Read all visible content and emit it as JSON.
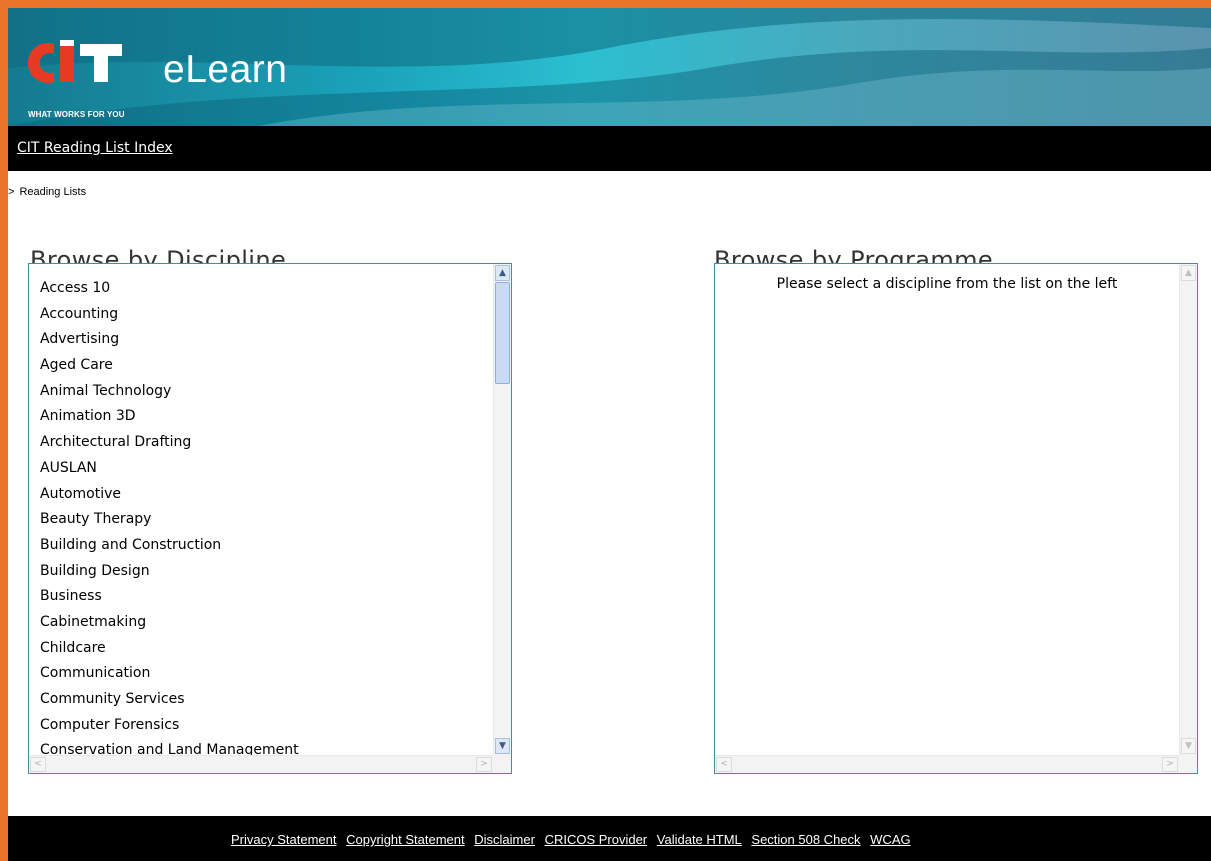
{
  "header": {
    "logo_text": "CIT",
    "logo_tagline": "WHAT WORKS FOR YOU",
    "app_title": "eLearn",
    "colors": {
      "frame": "#e9742a",
      "logo_red": "#e63a23",
      "logo_white": "#ffffff"
    }
  },
  "nav": {
    "index_link": "CIT Reading List Index"
  },
  "breadcrumb": {
    "separator": ">",
    "current": "Reading Lists"
  },
  "discipline": {
    "heading": "Browse by Discipline",
    "items": [
      "Access 10",
      "Accounting",
      "Advertising",
      "Aged Care",
      "Animal Technology",
      "Animation 3D",
      "Architectural Drafting",
      "AUSLAN",
      "Automotive",
      "Beauty Therapy",
      "Building and Construction",
      "Building Design",
      "Business",
      "Cabinetmaking",
      "Childcare",
      "Communication",
      "Community Services",
      "Computer Forensics",
      "Conservation and Land Management"
    ]
  },
  "programme": {
    "heading": "Browse by Programme",
    "message": "Please select a discipline from the list on the left"
  },
  "footer": {
    "links": [
      "Privacy Statement",
      "Copyright Statement",
      "Disclaimer",
      "CRICOS Provider",
      "Validate HTML",
      "Section 508 Check",
      "WCAG"
    ]
  },
  "icons": {
    "scroll_up": "▲",
    "scroll_down": "▼",
    "scroll_left": "<",
    "scroll_right": ">"
  }
}
